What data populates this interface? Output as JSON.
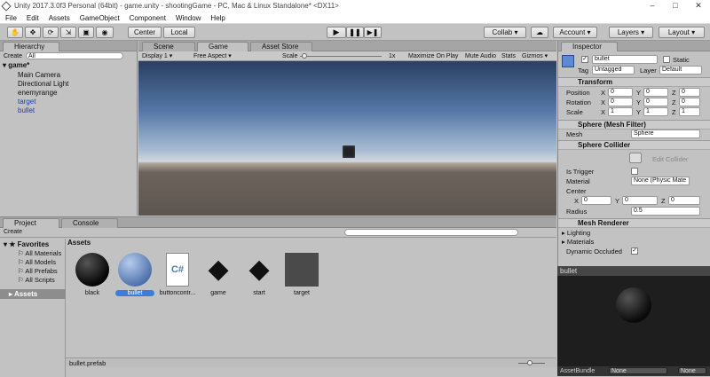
{
  "window": {
    "title": "Unity 2017.3.0f3 Personal (64bit) - game.unity - shootingGame - PC, Mac & Linux Standalone* <DX11>"
  },
  "menu": [
    "File",
    "Edit",
    "Assets",
    "GameObject",
    "Component",
    "Window",
    "Help"
  ],
  "toolbar": {
    "center": "Center",
    "local": "Local",
    "collab": "Collab",
    "account": "Account",
    "layers": "Layers",
    "layout": "Layout"
  },
  "hierarchy": {
    "tab": "Hierarchy",
    "create": "Create",
    "search_placeholder": "All",
    "scene": "game*",
    "items": [
      {
        "label": "Main Camera",
        "color": "#111"
      },
      {
        "label": "Directional Light",
        "color": "#111"
      },
      {
        "label": "enemyrange",
        "color": "#111"
      },
      {
        "label": "target",
        "color": "#1c3fb0"
      },
      {
        "label": "bullet",
        "color": "#1c3fb0"
      }
    ]
  },
  "view_tabs": {
    "scene": "Scene",
    "game": "Game",
    "asset_store": "Asset Store"
  },
  "game": {
    "display": "Display 1",
    "aspect": "Free Aspect",
    "scale_label": "Scale",
    "scale_value": "1x",
    "maximize": "Maximize On Play",
    "mute": "Mute Audio",
    "stats": "Stats",
    "gizmos": "Gizmos"
  },
  "project": {
    "tab": "Project",
    "console": "Console",
    "create": "Create",
    "favorites": "Favorites",
    "fav_items": [
      "All Materials",
      "All Models",
      "All Prefabs",
      "All Scripts"
    ],
    "assets_root": "Assets",
    "breadcrumb": "Assets",
    "selected_file": "bullet.prefab",
    "assets": [
      {
        "name": "black",
        "kind": "sphere-black"
      },
      {
        "name": "bullet",
        "kind": "sphere-blue"
      },
      {
        "name": "buttoncontr...",
        "kind": "script"
      },
      {
        "name": "game",
        "kind": "unity"
      },
      {
        "name": "start",
        "kind": "unity"
      },
      {
        "name": "target",
        "kind": "gray"
      }
    ]
  },
  "inspector": {
    "tab": "Inspector",
    "name": "bullet",
    "static": "Static",
    "tag_label": "Tag",
    "tag": "Untagged",
    "layer_label": "Layer",
    "layer": "Default",
    "transform": {
      "title": "Transform",
      "rows": [
        {
          "label": "Position",
          "x": "0",
          "y": "0",
          "z": "0"
        },
        {
          "label": "Rotation",
          "x": "0",
          "y": "0",
          "z": "0"
        },
        {
          "label": "Scale",
          "x": "1",
          "y": "1",
          "z": "1"
        }
      ]
    },
    "mesh_filter": {
      "title": "Sphere (Mesh Filter)",
      "mesh_label": "Mesh",
      "mesh": "Sphere"
    },
    "collider": {
      "title": "Sphere Collider",
      "edit": "Edit Collider",
      "is_trigger": "Is Trigger",
      "material_label": "Material",
      "material": "None (Physic Mate",
      "center": "Center",
      "cx": "0",
      "cy": "0",
      "cz": "0",
      "radius_label": "Radius",
      "radius": "0.5"
    },
    "renderer": {
      "title": "Mesh Renderer",
      "lighting": "Lighting",
      "materials": "Materials",
      "dyn_occ": "Dynamic Occluded"
    },
    "preview": {
      "title": "bullet",
      "assetbundle": "AssetBundle",
      "ab_value": "None",
      "ab_variant": "None"
    }
  }
}
